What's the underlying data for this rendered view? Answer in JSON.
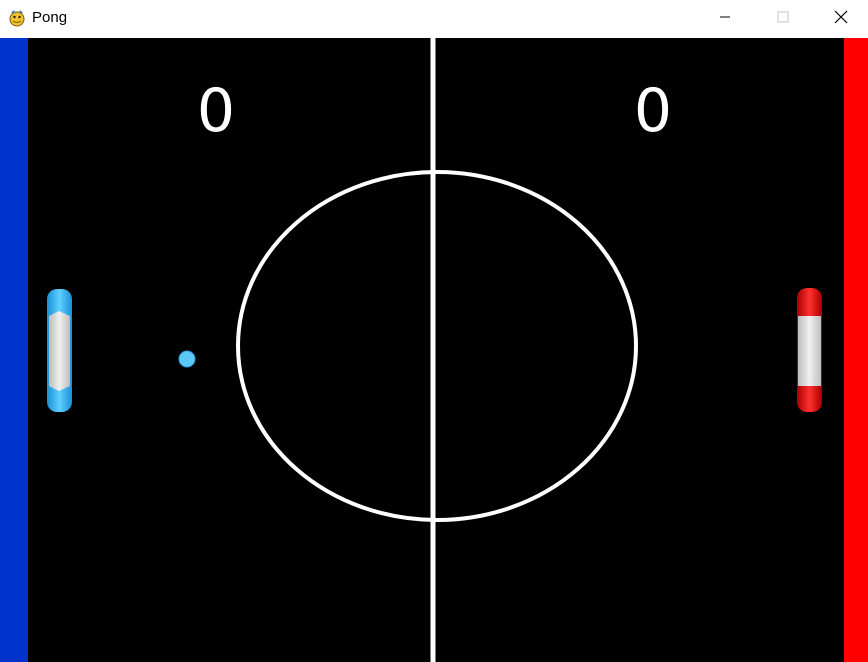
{
  "window": {
    "title": "Pong",
    "app_icon": "python-snake-icon",
    "controls": {
      "minimize_icon": "minimize-icon",
      "maximize_icon": "maximize-icon",
      "close_icon": "close-icon"
    }
  },
  "game": {
    "background_color": "#000000",
    "line_color": "#ffffff",
    "left_wall_color": "#0033cc",
    "right_wall_color": "#ff0000",
    "scores": {
      "left": "0",
      "right": "0"
    },
    "left_paddle": {
      "color": "#33b5ee",
      "core_color": "#d9d9d9"
    },
    "right_paddle": {
      "color": "#dd1111",
      "core_color": "#d9d9d9"
    },
    "ball": {
      "color": "#5cc8f5"
    }
  }
}
